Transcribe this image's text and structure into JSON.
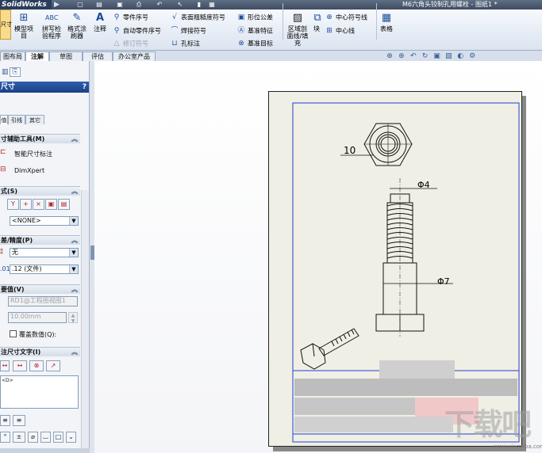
{
  "app": {
    "name": "SolidWorks",
    "document_title": "M6六角头铰制孔用螺栓 - 图纸1 *"
  },
  "ribbon": {
    "active_button": "尺寸",
    "model_items": {
      "l1": "模型项",
      "l2": "目"
    },
    "spell_check": {
      "l1": "拼写检",
      "l2": "验程序"
    },
    "format_painter": {
      "l1": "格式涂",
      "l2": "刷器"
    },
    "note": "注释",
    "balloon": "零件序号",
    "auto_balloon": "自动零件序号",
    "magnetic_line": "修订符号",
    "surface_finish": "表面粗糙度符号",
    "weld_symbol": "焊接符号",
    "hole_callout": "孔标注",
    "geometric_tolerance": "形位公差",
    "datum_feature": "基准特征",
    "datum_target": "基准目标",
    "area_hatch": {
      "l1": "区域剖",
      "l2": "面线/填",
      "l3": "充"
    },
    "block": "块",
    "center_mark": "中心符号线",
    "centerline": "中心线",
    "table": "表格"
  },
  "tabs": [
    {
      "label": "图布局",
      "active": false
    },
    {
      "label": "注解",
      "active": true
    },
    {
      "label": "草图",
      "active": false
    },
    {
      "label": "评估",
      "active": false
    },
    {
      "label": "办公室产品",
      "active": false
    }
  ],
  "panel": {
    "title": "尺寸",
    "help": "?",
    "subtabs": [
      "值",
      "引线",
      "其它"
    ],
    "smart_tools": {
      "header": "寸辅助工具(M)",
      "items": [
        "智能尺寸标注",
        "DimXpert"
      ]
    },
    "style": {
      "header": "式(S)",
      "selected": "<NONE>"
    },
    "tolerance": {
      "header": "差/精度(P)",
      "tolerance_type": "无",
      "precision": ".12 (文件)"
    },
    "primary_value": {
      "header": "要值(V)",
      "name": "RD1@工程图视图1",
      "value": "10.00mm",
      "override_label": "覆盖数值(Q):"
    },
    "dimension_text": {
      "header": "注尺寸文字(I)",
      "content": "<D>"
    }
  },
  "drawing": {
    "dim_hex_width": "10",
    "dim_thread_dia": "Φ4",
    "dim_shank_dia": "Φ7"
  },
  "watermark": {
    "text": "下载吧",
    "url": "www.xiazaiba.com"
  }
}
